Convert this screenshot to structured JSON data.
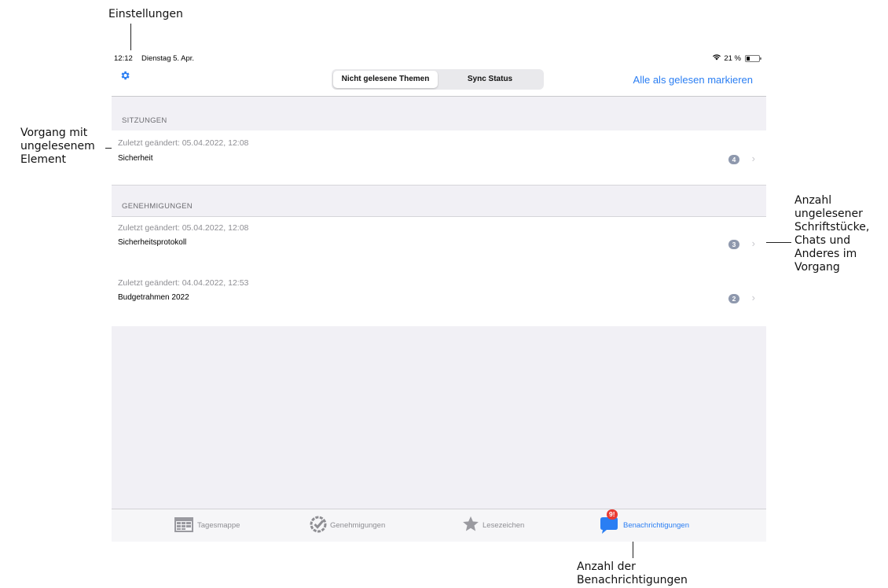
{
  "annotations": {
    "settings": "Einstellungen",
    "unread_item": [
      "Vorgang mit",
      "ungelesenem",
      "Element"
    ],
    "unread_count": [
      "Anzahl",
      "ungelesener",
      "Schriftstücke,",
      "Chats und",
      "Anderes im",
      "Vorgang"
    ],
    "notification_count": [
      "Anzahl der",
      "Benachrichtigungen"
    ]
  },
  "status_bar": {
    "time": "12:12",
    "date": "Dienstag 5. Apr.",
    "battery": "21 %"
  },
  "toolbar": {
    "segments": [
      "Nicht gelesene Themen",
      "Sync Status"
    ],
    "active_segment": 0,
    "mark_all_label": "Alle als gelesen markieren"
  },
  "sections": [
    {
      "header": "SITZUNGEN",
      "items": [
        {
          "meta": "Zuletzt geändert: 05.04.2022, 12:08",
          "title": "Sicherheit",
          "badge": "4"
        }
      ]
    },
    {
      "header": "GENEHMIGUNGEN",
      "items": [
        {
          "meta": "Zuletzt geändert: 05.04.2022, 12:08",
          "title": "Sicherheitsprotokoll",
          "badge": "3"
        },
        {
          "meta": "Zuletzt geändert: 04.04.2022, 12:53",
          "title": "Budgetrahmen 2022",
          "badge": "2"
        }
      ]
    }
  ],
  "tabbar": {
    "tabs": [
      "Tagesmappe",
      "Genehmigungen",
      "Lesezeichen",
      "Benachrichtigungen"
    ],
    "active": 3,
    "notification_badge": "9!"
  },
  "colors": {
    "accent": "#2a7ef3",
    "badge_gray": "#8e98ad",
    "notification_red": "#ea3b32",
    "background": "#f1f0f5"
  }
}
